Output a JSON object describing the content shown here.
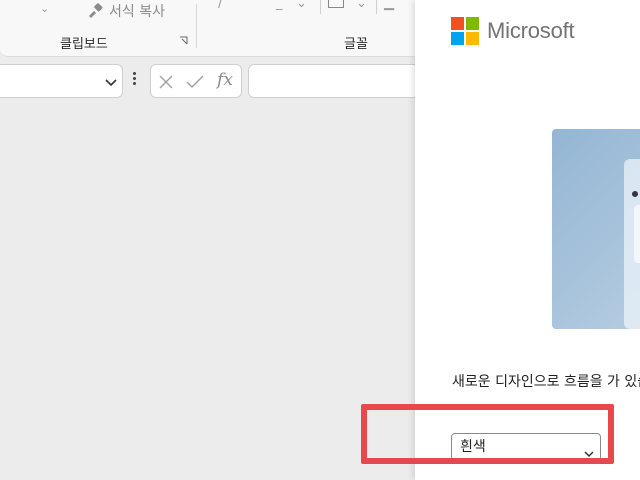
{
  "ribbon": {
    "format_painter_label": "서식 복사",
    "clipboard_group_label": "클립보드",
    "font_group_label": "글꼴"
  },
  "formula_bar": {
    "fx_label": "fx"
  },
  "panel": {
    "brand": "Microsoft",
    "logo_colors": [
      "#f25022",
      "#7fba00",
      "#00a4ef",
      "#ffb900"
    ],
    "description": "새로운 디자인으로 흐름을 가 있습니다.",
    "theme_select": {
      "selected": "흰색"
    }
  },
  "highlight_color": "#e5484d",
  "icons": {
    "format_painter": "brush-icon",
    "dialog_launcher": "dialog-launcher-icon",
    "cancel": "close-icon",
    "enter": "check-icon",
    "dropdown": "chevron-down-icon"
  }
}
